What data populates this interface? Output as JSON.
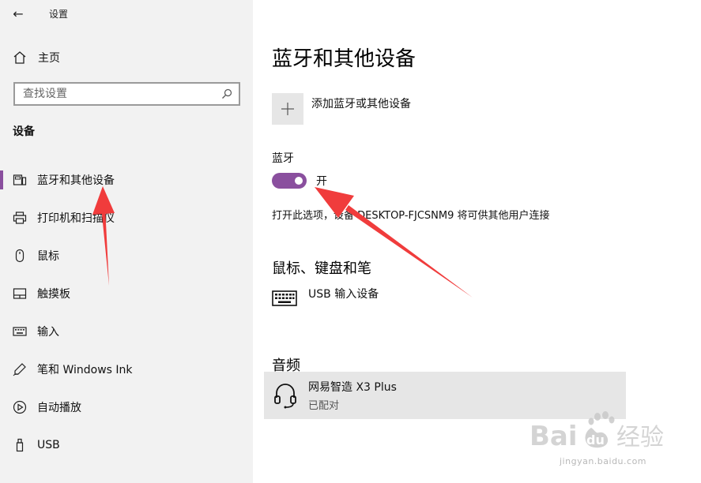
{
  "window": {
    "title": "设置",
    "back_glyph": "←"
  },
  "sidebar": {
    "home_label": "主页",
    "search_placeholder": "查找设置",
    "section_heading": "设备",
    "items": [
      {
        "label": "蓝牙和其他设备",
        "icon": "bluetooth-devices-icon",
        "selected": true
      },
      {
        "label": "打印机和扫描仪",
        "icon": "printer-icon",
        "selected": false
      },
      {
        "label": "鼠标",
        "icon": "mouse-icon",
        "selected": false
      },
      {
        "label": "触摸板",
        "icon": "touchpad-icon",
        "selected": false
      },
      {
        "label": "输入",
        "icon": "keyboard-icon",
        "selected": false
      },
      {
        "label": "笔和 Windows Ink",
        "icon": "pen-icon",
        "selected": false
      },
      {
        "label": "自动播放",
        "icon": "autoplay-icon",
        "selected": false
      },
      {
        "label": "USB",
        "icon": "usb-icon",
        "selected": false
      }
    ]
  },
  "main": {
    "title": "蓝牙和其他设备",
    "add_device_label": "添加蓝牙或其他设备",
    "add_glyph": "+",
    "bluetooth": {
      "label": "蓝牙",
      "toggle_state_text": "开",
      "enabled": true,
      "discoverable_text": "打开此选项，设备 DESKTOP-FJCSNM9 将可供其他用户连接"
    },
    "input_section": {
      "heading": "鼠标、键盘和笔",
      "devices": [
        {
          "name": "USB 输入设备",
          "icon": "keyboard-icon"
        }
      ]
    },
    "audio_section": {
      "heading": "音频",
      "devices": [
        {
          "name": "网易智造 X3 Plus",
          "status": "已配对",
          "icon": "headset-icon"
        }
      ]
    }
  },
  "watermark": {
    "text": "Bai du 经验",
    "sub": "jingyan.baidu.com"
  },
  "colors": {
    "accent": "#8a4f9e",
    "annotation_arrow": "#f03c3c",
    "sidebar_bg": "#f2f2f2"
  }
}
